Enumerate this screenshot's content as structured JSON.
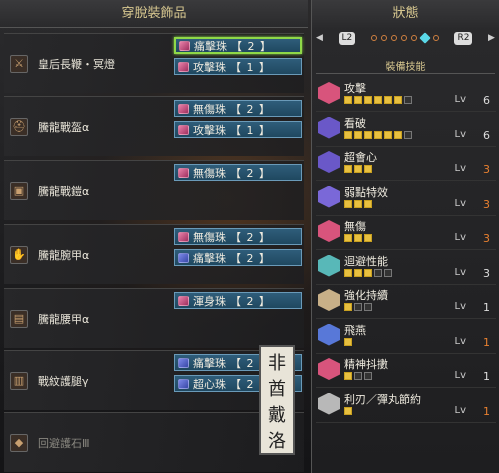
{
  "left": {
    "title": "穿脫裝飾品",
    "equipment": [
      {
        "name": "皇后長鞭・冥燈",
        "icon": "weapon",
        "slots": [
          {
            "label": "痛擊珠",
            "level": "【 2 】",
            "gem": "pink",
            "selected": true
          },
          {
            "label": "攻擊珠",
            "level": "【 1 】",
            "gem": "pink",
            "selected": false
          }
        ]
      },
      {
        "name": "騰龍戰盔α",
        "icon": "helm",
        "slots": [
          {
            "label": "無傷珠",
            "level": "【 2 】",
            "gem": "pink",
            "selected": false
          },
          {
            "label": "攻擊珠",
            "level": "【 1 】",
            "gem": "pink",
            "selected": false
          }
        ]
      },
      {
        "name": "騰龍戰鎧α",
        "icon": "chest",
        "slots": [
          {
            "label": "無傷珠",
            "level": "【 2 】",
            "gem": "pink",
            "selected": false
          }
        ]
      },
      {
        "name": "騰龍腕甲α",
        "icon": "arms",
        "slots": [
          {
            "label": "無傷珠",
            "level": "【 2 】",
            "gem": "pink",
            "selected": false
          },
          {
            "label": "痛擊珠",
            "level": "【 2 】",
            "gem": "blue",
            "selected": false
          }
        ]
      },
      {
        "name": "騰龍腰甲α",
        "icon": "waist",
        "slots": [
          {
            "label": "渾身珠",
            "level": "【 2 】",
            "gem": "pink",
            "selected": false
          }
        ]
      },
      {
        "name": "戰紋護腿γ",
        "icon": "legs",
        "slots": [
          {
            "label": "痛擊珠",
            "level": "【 2 】",
            "gem": "blue",
            "selected": false
          },
          {
            "label": "超心珠",
            "level": "【 2 】",
            "gem": "blue",
            "selected": false
          }
        ]
      },
      {
        "name": "回避護石Ⅲ",
        "icon": "charm",
        "dim": true,
        "slots": []
      }
    ],
    "watermark": [
      "非",
      "酋",
      "戴",
      "洛"
    ]
  },
  "right": {
    "title": "狀態",
    "nav_left": "L2",
    "nav_right": "R2",
    "nav_left_arrow": "◀",
    "nav_right_arrow": "▶",
    "skills_header": "裝備技能",
    "lv_label": "Lv",
    "skills": [
      {
        "name": "攻擊",
        "level": 6,
        "max": 7,
        "color": "#d8547c",
        "val_color": "white"
      },
      {
        "name": "看破",
        "level": 6,
        "max": 7,
        "color": "#6a58c8",
        "val_color": "white"
      },
      {
        "name": "超會心",
        "level": 3,
        "max": 3,
        "color": "#6a58c8",
        "val_color": "orange"
      },
      {
        "name": "弱點特效",
        "level": 3,
        "max": 3,
        "color": "#7a68d8",
        "val_color": "orange"
      },
      {
        "name": "無傷",
        "level": 3,
        "max": 3,
        "color": "#d8547c",
        "val_color": "orange"
      },
      {
        "name": "迴避性能",
        "level": 3,
        "max": 5,
        "color": "#58b8b8",
        "val_color": "white"
      },
      {
        "name": "強化持續",
        "level": 1,
        "max": 3,
        "color": "#c8b088",
        "val_color": "white"
      },
      {
        "name": "飛燕",
        "level": 1,
        "max": 1,
        "color": "#5878d8",
        "val_color": "orange"
      },
      {
        "name": "精神抖擻",
        "level": 1,
        "max": 3,
        "color": "#d8547c",
        "val_color": "white"
      },
      {
        "name": "利刃／彈丸節約",
        "level": 1,
        "max": 1,
        "color": "#b8b8b8",
        "val_color": "orange"
      }
    ]
  }
}
